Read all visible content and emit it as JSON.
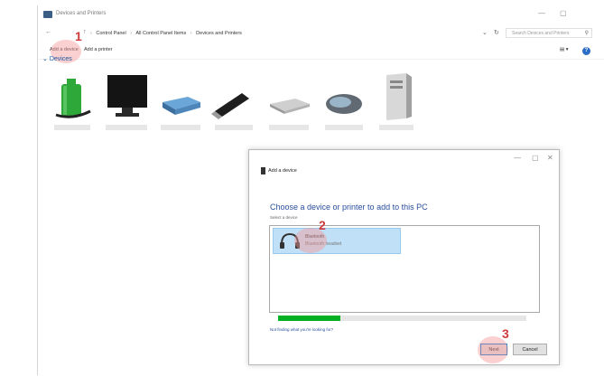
{
  "window": {
    "title": "Devices and Printers",
    "controls": {
      "minimize": "—",
      "maximize": "▢"
    }
  },
  "address_bar": {
    "crumbs": [
      "Control Panel",
      "All Control Panel Items",
      "Devices and Printers"
    ],
    "search_placeholder": "Search Devices and Printers"
  },
  "toolbar": {
    "add_device": "Add a device",
    "add_printer": "Add a printer"
  },
  "devices_section": {
    "label": "Devices",
    "items": [
      {
        "icon": "battery-icon"
      },
      {
        "icon": "monitor-icon"
      },
      {
        "icon": "external-drive-icon"
      },
      {
        "icon": "usb-drive-icon"
      },
      {
        "icon": "keyboard-icon"
      },
      {
        "icon": "mouse-icon"
      },
      {
        "icon": "pc-tower-icon"
      }
    ]
  },
  "steps": [
    "1",
    "2",
    "3"
  ],
  "dialog": {
    "title": "Add a device",
    "heading": "Choose a device or printer to add to this PC",
    "subheading": "Select a device",
    "device": {
      "name": "Bluetooth",
      "type": "Bluetooth headset",
      "icon": "headset-icon"
    },
    "progress": 0.25,
    "link": "Not finding what you're looking for?",
    "next_label": "Next",
    "cancel_label": "Cancel"
  },
  "colors": {
    "accent": "#0078d7",
    "progress": "#06b025",
    "heading": "#2a4e9c",
    "marker": "#d03a3a"
  }
}
